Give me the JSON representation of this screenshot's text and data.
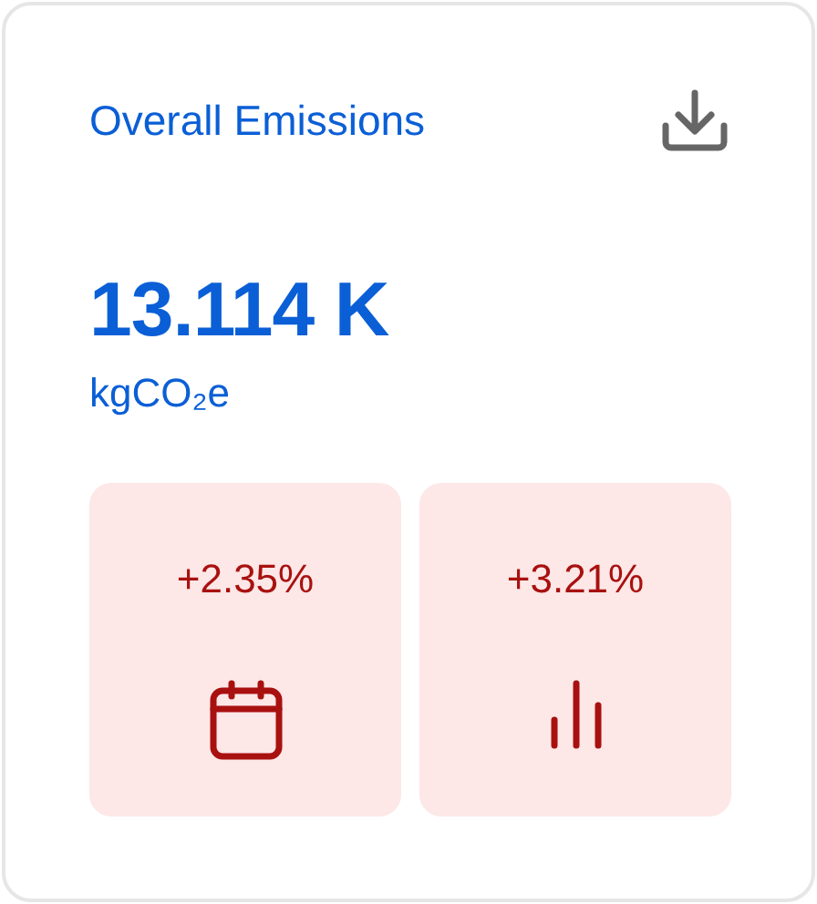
{
  "card": {
    "title": "Overall Emissions",
    "value": "13.114 K",
    "unit": "kgCO₂e"
  },
  "tiles": [
    {
      "change": "+2.35%",
      "kind": "calendar"
    },
    {
      "change": "+3.21%",
      "kind": "bars"
    }
  ]
}
